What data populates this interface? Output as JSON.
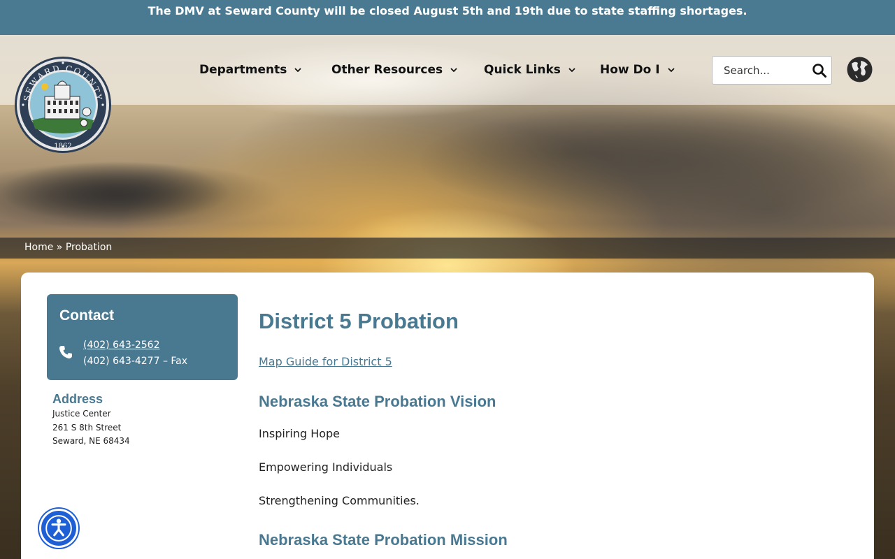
{
  "alert": {
    "text": "The DMV at Seward County will be closed August 5th and 19th due to state staffing shortages."
  },
  "logo": {
    "top_text": "SEWARD COUNTY",
    "year": "1862"
  },
  "nav": {
    "items": [
      {
        "label": "Departments"
      },
      {
        "label": "Other Resources"
      },
      {
        "label": "Quick Links"
      },
      {
        "label": "How Do I"
      }
    ]
  },
  "search": {
    "placeholder": "Search..."
  },
  "breadcrumb": {
    "home": "Home",
    "separator": " » ",
    "current": "Probation"
  },
  "sidebar": {
    "contact_title": "Contact",
    "phone": "(402) 643-2562",
    "fax": "(402) 643-4277 – Fax",
    "address_title": "Address",
    "address_lines": [
      "Justice Center",
      "261 S 8th Street",
      "Seward, NE 68434"
    ]
  },
  "main": {
    "title": "District 5 Probation",
    "map_link": "Map Guide for District 5",
    "vision_heading": "Nebraska State Probation Vision",
    "vision_items": [
      "Inspiring Hope",
      "Empowering Individuals",
      "Strengthening Communities."
    ],
    "mission_heading": "Nebraska State Probation Mission"
  },
  "colors": {
    "brand": "#497891",
    "alert_bg": "#4a7a92",
    "accessibility": "#1f5fd6"
  },
  "icons": {
    "search": "search-icon",
    "globe": "globe-icon",
    "phone": "phone-icon",
    "accessibility": "accessibility-icon"
  }
}
